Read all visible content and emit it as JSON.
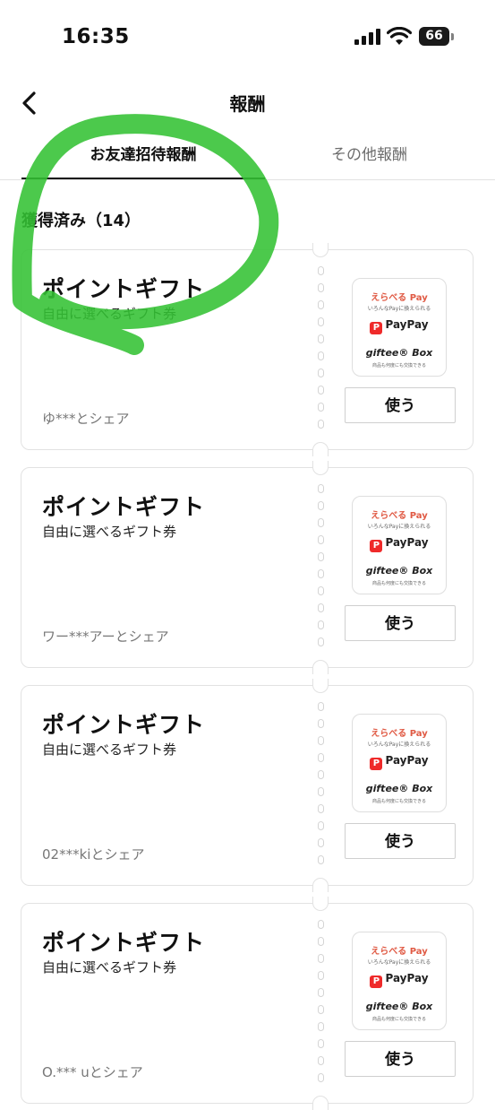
{
  "status_bar": {
    "time": "16:35",
    "battery_level": "66"
  },
  "header": {
    "title": "報酬"
  },
  "tabs": [
    {
      "label": "お友達招待報酬",
      "active": true
    },
    {
      "label": "その他報酬",
      "active": false
    }
  ],
  "section": {
    "heading": "獲得済み（14）"
  },
  "logo_text": {
    "erabel": "えらべる Pay",
    "erabel_sub": "いろんなPayに換えられる",
    "paypay": "PayPay",
    "paypay_mark": "P",
    "giftee": "giftee® Box",
    "giftee_sub": "商品も何度にも交換できる"
  },
  "cards": [
    {
      "title": "ポイントギフト",
      "subtitle": "自由に選べるギフト券",
      "shared_with": "ゆ***とシェア",
      "button_label": "使う"
    },
    {
      "title": "ポイントギフト",
      "subtitle": "自由に選べるギフト券",
      "shared_with": "ワー***アーとシェア",
      "button_label": "使う"
    },
    {
      "title": "ポイントギフト",
      "subtitle": "自由に選べるギフト券",
      "shared_with": "02***kiとシェア",
      "button_label": "使う"
    },
    {
      "title": "ポイントギフト",
      "subtitle": "自由に選べるギフト券",
      "shared_with": "O.*** uとシェア",
      "button_label": "使う"
    }
  ],
  "colors": {
    "annotation_stroke": "#33c233",
    "paypay_red": "#ef2a2a",
    "erabel_accent": "#e05a44"
  }
}
